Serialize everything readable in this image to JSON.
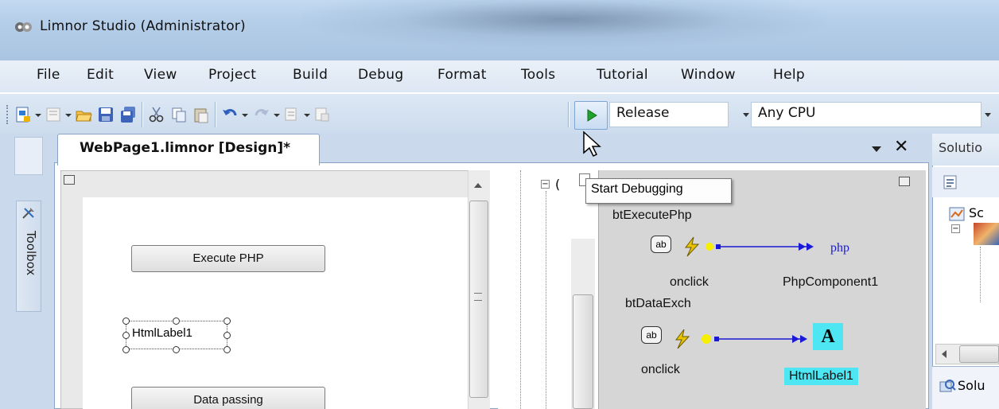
{
  "window": {
    "title": "Limnor Studio (Administrator)"
  },
  "menu": [
    "File",
    "Edit",
    "View",
    "Project",
    "Build",
    "Debug",
    "Format",
    "Tools",
    "Tutorial",
    "Window",
    "Help"
  ],
  "toolbar": {
    "configuration": "Release",
    "platform": "Any CPU",
    "tooltip": "Start Debugging"
  },
  "sidebar": {
    "toolbox_label": "Toolbox"
  },
  "document_tab": {
    "label": "WebPage1.limnor [Design]*"
  },
  "designer": {
    "buttons": [
      "Execute PHP",
      "Data passing"
    ],
    "label_text": "HtmlLabel1"
  },
  "tree": {
    "root_fragment": "("
  },
  "event_map": {
    "button1": "btExecutePhp",
    "button2": "btDataExch",
    "event1": "onclick",
    "event2": "onclick",
    "target1": "PhpComponent1",
    "target1_icon_text": "php",
    "target2": "HtmlLabel1",
    "target2_icon_text": "A",
    "ab_icon_text": "ab"
  },
  "solution_panel": {
    "header": "Solutio",
    "item1": "Sc",
    "bottom_tab": "Solu"
  },
  "colors": {
    "highlight": "#4de6f2",
    "arrow": "#1a1ad6",
    "lightning": "#e8c400"
  }
}
